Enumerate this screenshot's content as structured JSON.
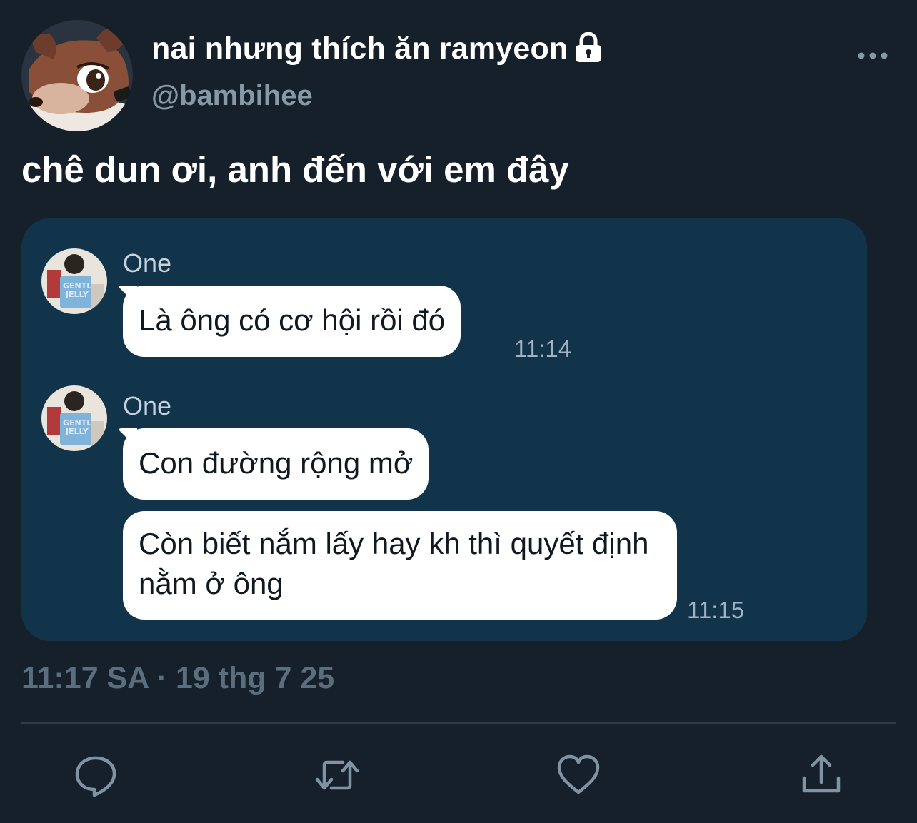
{
  "author": {
    "display_name": "nai nhưng thích ăn ramyeon",
    "handle": "@bambihee",
    "avatar_icon": "fawn-avatar",
    "verified_icon": "lock-icon"
  },
  "tweet": {
    "text": "chê dun ơi, anh đến với em đây",
    "timestamp": "11:17 SA · 19 thg 7 25"
  },
  "chat": {
    "messages": [
      {
        "sender": "One",
        "text": "Là ông có cơ hội rồi đó",
        "time": "11:14"
      },
      {
        "sender": "One",
        "text": "Con đường rộng mở",
        "time": ""
      },
      {
        "sender": "",
        "text": "Còn biết nắm lấy hay kh thì quyết định nằm ở ông",
        "time": "11:15"
      }
    ]
  },
  "actions": [
    {
      "name": "reply-icon"
    },
    {
      "name": "retweet-icon"
    },
    {
      "name": "like-icon"
    },
    {
      "name": "share-icon"
    }
  ],
  "colors": {
    "background": "#15202b",
    "card": "#11344b",
    "muted": "#8899a6",
    "icon": "#7f93a3"
  }
}
